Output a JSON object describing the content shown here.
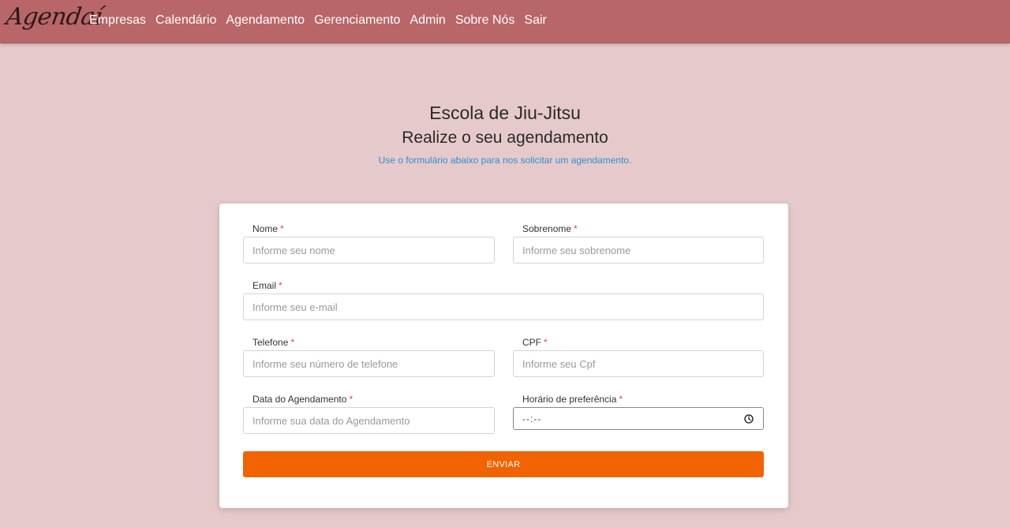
{
  "nav": {
    "brand": "Agendaí",
    "links": [
      "Empresas",
      "Calendário",
      "Agendamento",
      "Gerenciamento",
      "Admin",
      "Sobre Nós",
      "Sair"
    ]
  },
  "hero": {
    "title": "Escola de Jiu-Jitsu",
    "subtitle": "Realize o seu agendamento",
    "description": "Use o formulário abaixo para nos solicitar um agendamento."
  },
  "form": {
    "required_mark": "*",
    "nome": {
      "label": "Nome",
      "placeholder": "Informe seu nome",
      "value": ""
    },
    "sobrenome": {
      "label": "Sobrenome",
      "placeholder": "Informe seu sobrenome",
      "value": ""
    },
    "email": {
      "label": "Email",
      "placeholder": "Informe seu e-mail",
      "value": ""
    },
    "telefone": {
      "label": "Telefone",
      "placeholder": "Informe seu número de telefone",
      "value": ""
    },
    "cpf": {
      "label": "CPF",
      "placeholder": "Informe seu Cpf",
      "value": ""
    },
    "data": {
      "label": "Data do Agendamento",
      "placeholder": "Informe sua data do Agendamento",
      "value": ""
    },
    "horario": {
      "label": "Horário de preferência",
      "value": "--:--",
      "icon": "clock-icon"
    },
    "submit_label": "ENVIAR"
  },
  "colors": {
    "navbar": "#b96668",
    "background": "#e6cacb",
    "accent_button": "#f06300",
    "description_link": "#2f8fd0",
    "required": "#d94848"
  }
}
